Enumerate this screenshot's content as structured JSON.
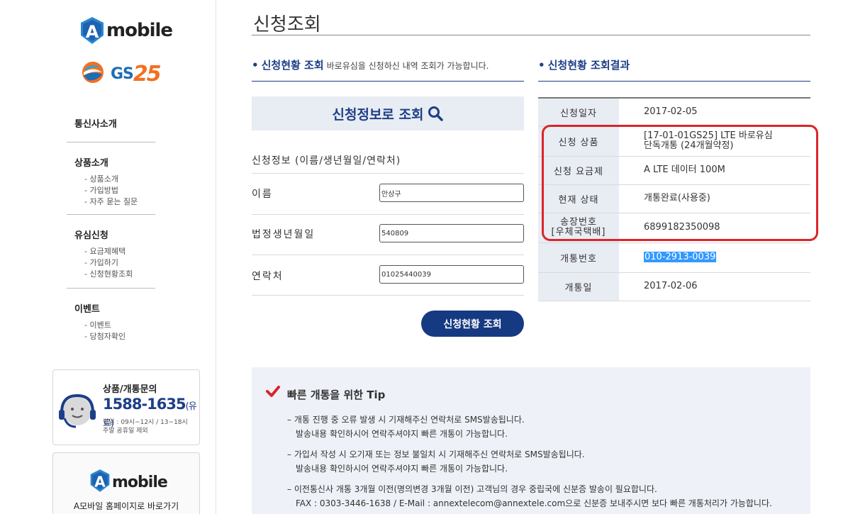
{
  "sidebar": {
    "logo_text": "mobile",
    "logo_letter": "A",
    "gs_text": "GS",
    "gs_num": "25",
    "menu": [
      {
        "title": "통신사소개",
        "subs": []
      },
      {
        "title": "상품소개",
        "subs": [
          "- 상품소개",
          "- 가입방법",
          "- 자주 묻는 질문"
        ]
      },
      {
        "title": "유심신청",
        "subs": [
          "- 요금제혜택",
          "- 가입하기",
          "- 신청현황조회"
        ]
      },
      {
        "title": "이벤트",
        "subs": [
          "- 이벤트",
          "- 당첨자확인"
        ]
      }
    ],
    "cs": {
      "title": "상품/개통문의",
      "phone": "1588-1635",
      "phone_note": "(유료)",
      "hours1": "평일 : 09시~12시 / 13~18시",
      "hours2": "주말 공휴일 제외"
    },
    "home": {
      "logo_text": "mobile",
      "logo_letter": "A",
      "caption": "A모바일 홈페이지로 바로가기"
    }
  },
  "main": {
    "page_title": "신청조회",
    "query": {
      "heading": "신청현황 조회",
      "desc": "바로유심을 신청하신 내역 조회가 가능합니다.",
      "search_label": "신청정보로 조회",
      "form_caption": "신청정보 (이름/생년월일/연락처)",
      "fields": [
        {
          "label": "이름",
          "value": "안상구"
        },
        {
          "label": "법정생년월일",
          "value": "540809"
        },
        {
          "label": "연락처",
          "value": "01025440039"
        }
      ],
      "submit": "신청현황 조회"
    },
    "result": {
      "heading": "신청현황 조회결과",
      "rows": [
        {
          "key": "신청일자",
          "value": "2017-02-05"
        },
        {
          "key": "신청 상품",
          "value": "[17-01-01GS25] LTE 바로유심",
          "value2": "단독개통 (24개월약정)"
        },
        {
          "key": "신청 요금제",
          "value": "A LTE 데이터 100M"
        },
        {
          "key": "현재 상태",
          "value": "개통완료(사용중)"
        },
        {
          "key": "송장번호",
          "key2": "[우체국택배]",
          "value": "6899182350098"
        },
        {
          "key": "개통번호",
          "value": "010-2913-0039"
        },
        {
          "key": "개통일",
          "value": "2017-02-06"
        }
      ]
    },
    "tip": {
      "title": "빠른 개통을 위한 Tip",
      "items": [
        {
          "l1": "– 개통 진행 중 오류 발생 시 기재해주신 연락처로 SMS발송됩니다.",
          "l2": "발송내용 확인하시어 연락주셔야지 빠른 개통이 가능합니다."
        },
        {
          "l1": "– 가입서 작성 시 오기재 또는 정보 불일치 시 기재해주신 연락처로 SMS발송됩니다.",
          "l2": "발송내용 확인하시어 연락주셔야지 빠른 개통이 가능합니다."
        },
        {
          "l1": "– 이전통신사 개통 3개월 이전(명의변경 3개월 이전) 고객님의 경우 중립국에 신분증 발송이 필요합니다.",
          "l2": "FAX : 0303-3446-1638 / E-Mail : annextelecom@annextele.com으로 신분증 보내주시면 보다 빠른 개통처리가 가능합니다."
        }
      ]
    }
  },
  "colors": {
    "navy": "#1d3f87",
    "button_navy": "#163a82",
    "highlight_red": "#d9252b",
    "table_key_bg": "#e8ecf3",
    "tip_bg": "#eef1f7",
    "gs_blue": "#1e6db5",
    "gs_orange": "#f36f21"
  }
}
